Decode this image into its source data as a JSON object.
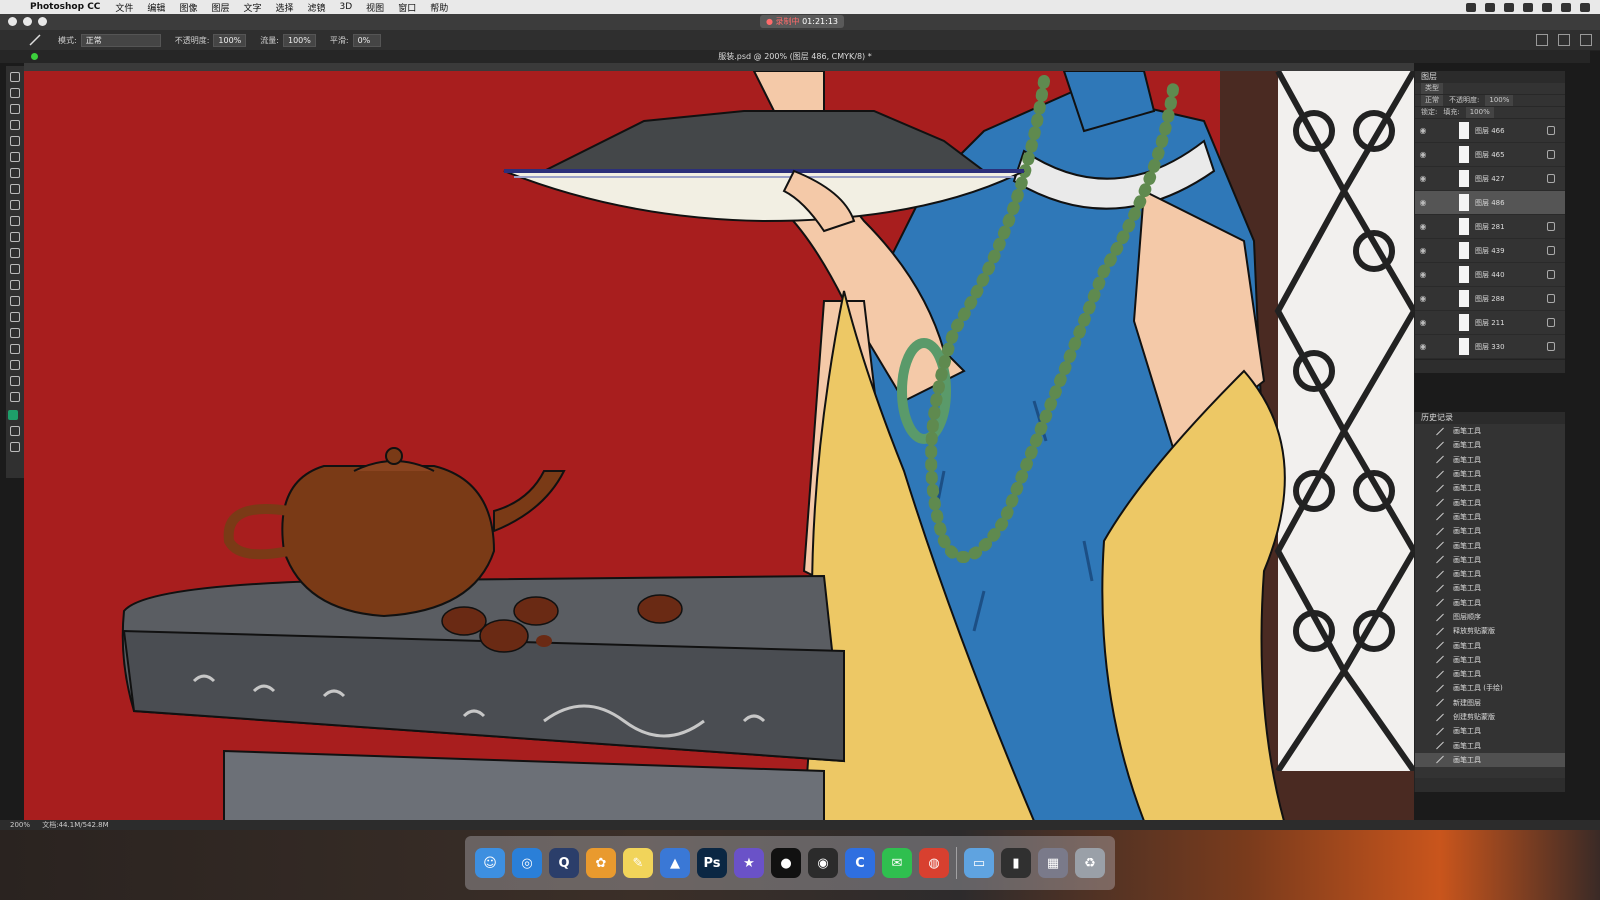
{
  "menubar": {
    "app_name": "Photoshop CC",
    "items": [
      "文件",
      "编辑",
      "图像",
      "图层",
      "文字",
      "选择",
      "滤镜",
      "3D",
      "视图",
      "窗口",
      "帮助"
    ]
  },
  "window": {
    "recording_label": "录制中",
    "recording_time": "01:21:13"
  },
  "options_bar": {
    "mode_label": "模式:",
    "mode_value": "正常",
    "opacity_label": "不透明度:",
    "opacity_value": "100%",
    "flow_label": "流量:",
    "flow_value": "100%",
    "smoothing_label": "平滑:",
    "smoothing_value": "0%"
  },
  "document": {
    "title": "服装.psd @ 200% (图层 486, CMYK/8) *"
  },
  "status": {
    "zoom": "200%",
    "doc_size": "文档:44.1M/542.8M"
  },
  "layers_panel": {
    "title": "图层",
    "filter_label": "类型",
    "blend_mode": "正常",
    "opacity_label": "不透明度:",
    "opacity_value": "100%",
    "lock_label": "锁定:",
    "fill_label": "填充:",
    "fill_value": "100%",
    "layers": [
      "图层 466",
      "图层 465",
      "图层 427",
      "图层 486",
      "图层 281",
      "图层 439",
      "图层 440",
      "图层 288",
      "图层 211",
      "图层 330"
    ],
    "selected_index": 3
  },
  "history_panel": {
    "title": "历史记录",
    "items": [
      "画笔工具",
      "画笔工具",
      "画笔工具",
      "画笔工具",
      "画笔工具",
      "画笔工具",
      "画笔工具",
      "画笔工具",
      "画笔工具",
      "画笔工具",
      "画笔工具",
      "画笔工具",
      "画笔工具",
      "图层顺序",
      "释放剪贴蒙版",
      "画笔工具",
      "画笔工具",
      "画笔工具",
      "画笔工具 (手绘)",
      "新建图层",
      "创建剪贴蒙版",
      "画笔工具",
      "画笔工具",
      "画笔工具"
    ]
  },
  "dock": {
    "apps": [
      {
        "name": "finder-icon",
        "glyph": "☺",
        "color": "#3d8fe0"
      },
      {
        "name": "safari-icon",
        "glyph": "◎",
        "color": "#2a7fd8"
      },
      {
        "name": "quicktime-icon",
        "glyph": "Q",
        "color": "#2b3e6a"
      },
      {
        "name": "photos-icon",
        "glyph": "✿",
        "color": "#e99a2e"
      },
      {
        "name": "notes-icon",
        "glyph": "✎",
        "color": "#f1d45a"
      },
      {
        "name": "keynote-icon",
        "glyph": "▲",
        "color": "#3a78d6"
      },
      {
        "name": "photoshop-icon",
        "glyph": "Ps",
        "color": "#0b2743"
      },
      {
        "name": "imovie-icon",
        "glyph": "★",
        "color": "#6a52c8"
      },
      {
        "name": "qq-icon",
        "glyph": "●",
        "color": "#111111"
      },
      {
        "name": "camera-icon",
        "glyph": "◉",
        "color": "#2b2b2b"
      },
      {
        "name": "browser-icon",
        "glyph": "C",
        "color": "#2f6fe0"
      },
      {
        "name": "wechat-icon",
        "glyph": "✉",
        "color": "#2fbf4f"
      },
      {
        "name": "chrome-icon",
        "glyph": "◍",
        "color": "#d8402f"
      },
      {
        "name": "folder-icon",
        "glyph": "▭",
        "color": "#5fa3e0"
      },
      {
        "name": "files-icon",
        "glyph": "▮",
        "color": "#303030"
      },
      {
        "name": "launchpad-icon",
        "glyph": "▦",
        "color": "#7a7a8a"
      },
      {
        "name": "trash-icon",
        "glyph": "♻",
        "color": "#9aa0a8"
      }
    ]
  },
  "colors": {
    "canvas_bg": "#a81e1e",
    "dress": "#2f78b8",
    "shawl": "#edc865",
    "teapot": "#7a3a16",
    "table": "#5a5d62"
  }
}
